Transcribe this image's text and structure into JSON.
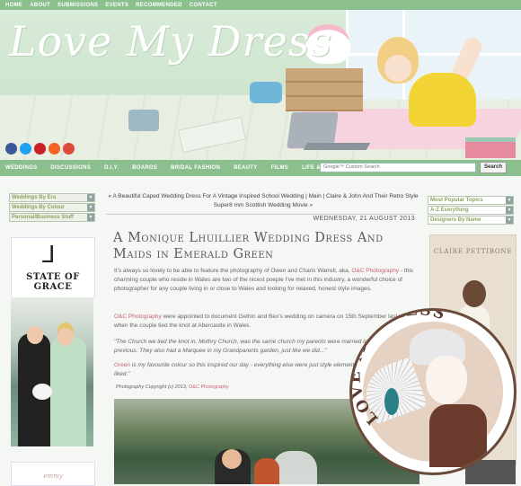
{
  "topnav": [
    "HOME",
    "ABOUT",
    "SUBMISSIONS",
    "EVENTS",
    "RECOMMENDED",
    "CONTACT"
  ],
  "header": {
    "logo": "Love My Dress"
  },
  "social": [
    {
      "name": "facebook-icon",
      "color": "#3b5998"
    },
    {
      "name": "twitter-icon",
      "color": "#1da1f2"
    },
    {
      "name": "pinterest-icon",
      "color": "#cb2027"
    },
    {
      "name": "rss-icon",
      "color": "#f26522"
    },
    {
      "name": "google-plus-icon",
      "color": "#dd4b39"
    }
  ],
  "mainnav": [
    "WEDDINGS",
    "DISCUSSIONS",
    "D.I.Y.",
    "BOARDS",
    "BRIDAL FASHION",
    "BEAUTY",
    "FILMS",
    "LIFE & LOVE"
  ],
  "search": {
    "placeholder": "Google™ Custom Search",
    "button": "Search"
  },
  "left": {
    "selects": [
      "Weddings By Era",
      "Weddings By Colour",
      "Personal/Business Stuff"
    ],
    "sponsor1": "STATE OF GRACE",
    "sponsor2": "emmy"
  },
  "post": {
    "prev": "« A Beautiful Caped Wedding Dress For A Vintage Inspired School Wedding",
    "main": "Main",
    "next": "Claire & John And Their Retro Style Super8 mm Scottish Wedding Movie »",
    "date": "WEDNESDAY, 21 AUGUST 2013",
    "title": "A Monique Lhuillier Wedding Dress And Maids in Emerald Green",
    "p1a": "It's always so lovely to be able to feature the photography of Owen and Charis Warrell, aka, ",
    "p1link": "O&C Photography",
    "p1b": " - this charming couple who reside in Wales are two of the nicest poeple I've met in this industry, a wonderful choice of photographer for any couple living in or close to Wales and looking for relaxed, honest style images.",
    "p2link": "O&C Photography",
    "p2b": " were appointed to document Gethin and Bex's wedding on camera on 15th September last year, when the couple tied the knot at Abercastle in Wales.",
    "p3": "\"The Church we tied the knot in,  Mothry Church, was the same church my parents were married in 30 years previous. They also had a Marquee in my Grandparents garden, just like we did...\"",
    "p4link": "Green",
    "p4b": " is my favourite colour so this inspired our day - everything else were just style elements we thought of and liked.\"",
    "credit": "Photography Copyright (c) 2013, ",
    "creditlink": "O&C Photography"
  },
  "right": {
    "selects": [
      "Most Popular Topics",
      "A-Z Everything",
      "Designers By Name"
    ],
    "ad": "CLAIRE PETTIBONE"
  },
  "badge": {
    "text": "LOVE MY DRESS"
  }
}
